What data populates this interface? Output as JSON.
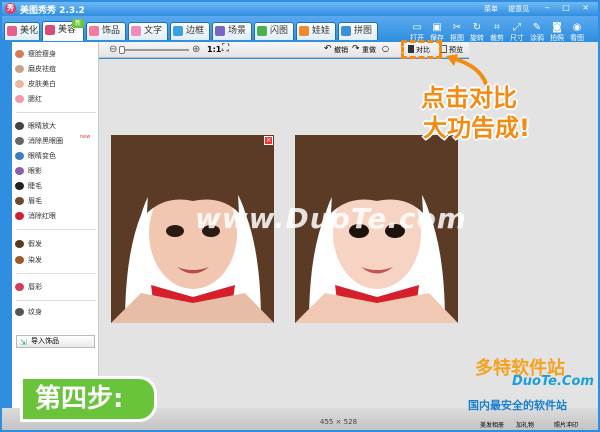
{
  "window": {
    "title": "美图秀秀 2.3.2",
    "links": [
      "菜单",
      "提意见"
    ],
    "controls": "‒ □ ×"
  },
  "tabs": [
    {
      "label": "美化",
      "color": "#e9608f"
    },
    {
      "label": "美容",
      "color": "#d64c7d",
      "badge": "新",
      "active": true
    },
    {
      "label": "饰品",
      "color": "#f27ca0"
    },
    {
      "label": "文字",
      "color": "#f08cbc"
    },
    {
      "label": "边框",
      "color": "#3aa0e0"
    },
    {
      "label": "场景",
      "color": "#7a64c6"
    },
    {
      "label": "闪图",
      "color": "#4bb34b"
    },
    {
      "label": "娃娃",
      "color": "#f08a2c"
    },
    {
      "label": "拼图",
      "color": "#3d8fd6"
    }
  ],
  "toolbar_actions": [
    "打开",
    "保存",
    "抠图",
    "旋转",
    "裁剪",
    "尺寸",
    "涂鸦",
    "拍照",
    "看图"
  ],
  "view": {
    "zoom_label": "1:1",
    "undo": "撤销",
    "redo": "重做",
    "compare": "对比",
    "preview": "预览"
  },
  "sidebar": [
    {
      "label": "瘦脸瘦身",
      "color": "#d77c5a"
    },
    {
      "label": "磨皮祛痘",
      "color": "#c9a189"
    },
    {
      "label": "皮肤美白",
      "color": "#e8b8a0"
    },
    {
      "label": "腮红",
      "color": "#f19aa5"
    },
    {
      "label": "眼睛放大",
      "color": "#444"
    },
    {
      "label": "消除黑眼圈",
      "color": "#666",
      "badge": "new"
    },
    {
      "label": "眼睛变色",
      "color": "#3c7dbf"
    },
    {
      "label": "眼影",
      "color": "#8a5fa7"
    },
    {
      "label": "睫毛",
      "color": "#222"
    },
    {
      "label": "眉毛",
      "color": "#6a4b2e"
    },
    {
      "label": "消除红眼",
      "color": "#c23"
    },
    {
      "label": "假发",
      "color": "#5a3a20"
    },
    {
      "label": "染发",
      "color": "#9a5a2a"
    },
    {
      "label": "唇彩",
      "color": "#d83c5c"
    },
    {
      "label": "纹身",
      "color": "#555"
    }
  ],
  "import_label": "导入饰品",
  "image_size": "455 × 528",
  "annotation": {
    "line1": "点击对比",
    "line2": "大功告成!"
  },
  "step_label": "第四步:",
  "watermark": "www.DuoTe.com",
  "site": {
    "name": "多特软件站",
    "url": "DuoTe.Com",
    "slogan": "国内最安全的软件站"
  },
  "status_items": [
    "美发相册",
    "加礼物",
    "照片冲印"
  ],
  "accent": "#f58a10"
}
